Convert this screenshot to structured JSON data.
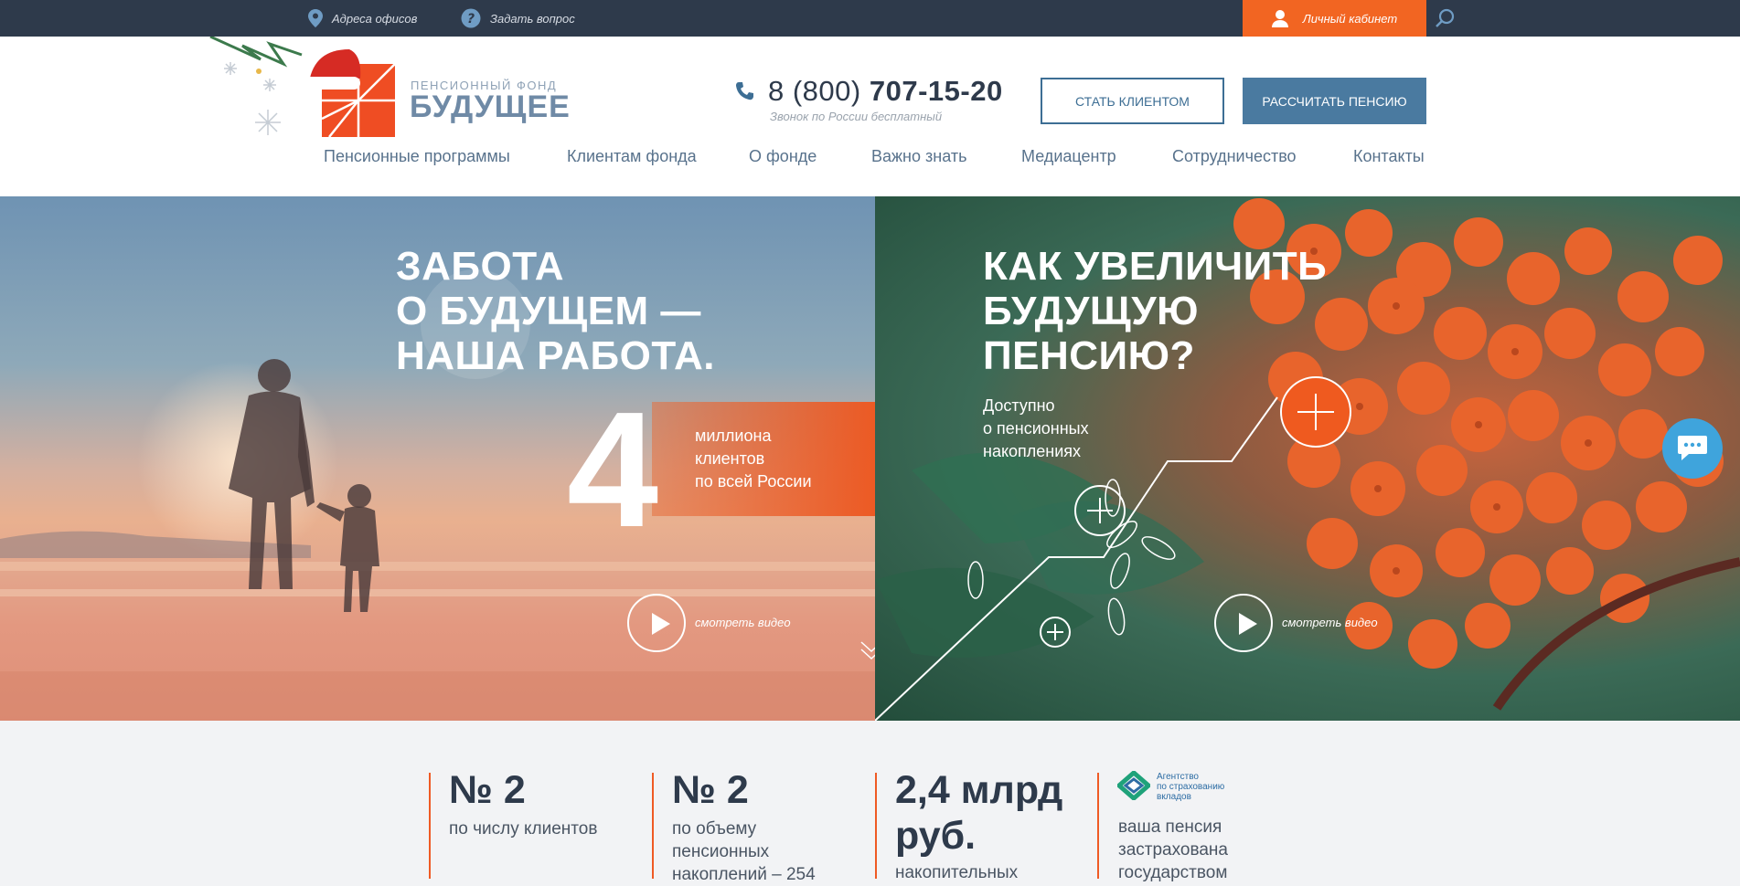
{
  "topbar": {
    "offices_label": "Адреса офисов",
    "ask_label": "Задать вопрос",
    "cabinet_label": "Личный кабинет"
  },
  "header": {
    "logo_small": "ПЕНСИОННЫЙ ФОНД",
    "logo_big": "БУДУЩЕЕ",
    "phone_prefix": "8 (800)",
    "phone_main": "707-15-20",
    "phone_note": "Звонок по России бесплатный",
    "btn_client": "СТАТЬ КЛИЕНТОМ",
    "btn_calc": "РАССЧИТАТЬ ПЕНСИЮ"
  },
  "nav": {
    "items": [
      "Пенсионные программы",
      "Клиентам фонда",
      "О фонде",
      "Важно знать",
      "Медиацентр",
      "Сотрудничество",
      "Контакты"
    ]
  },
  "hero_left": {
    "title_lines": [
      "ЗАБОТА",
      "О БУДУЩЕМ —",
      "НАША РАБОТА."
    ],
    "big_number": "4",
    "band_lines": [
      "миллиона",
      "клиентов",
      "по всей России"
    ],
    "video_label": "смотреть видео"
  },
  "hero_right": {
    "title_lines": [
      "КАК УВЕЛИЧИТЬ",
      "БУДУЩУЮ",
      "ПЕНСИЮ?"
    ],
    "sub_lines": [
      "Доступно",
      "о пенсионных",
      "накоплениях"
    ],
    "video_label": "смотреть видео"
  },
  "stats": {
    "items": [
      {
        "big": "№ 2",
        "text_lines": [
          "по числу клиентов"
        ]
      },
      {
        "big": "№ 2",
        "text_lines": [
          "по объему",
          "пенсионных",
          "накоплений – 254"
        ]
      },
      {
        "big_lines": [
          "2,4 млрд",
          "руб."
        ],
        "text_lines": [
          "накопительных"
        ]
      },
      {
        "logo_lines": [
          "Агентство",
          "по страхованию",
          "вкладов"
        ],
        "text_lines": [
          "ваша пенсия",
          "застрахована",
          "государством"
        ]
      }
    ]
  },
  "colors": {
    "topbar": "#2e3a4b",
    "accent": "#f26522",
    "brand_blue": "#4a7aa0",
    "nav_text": "#58728c"
  }
}
